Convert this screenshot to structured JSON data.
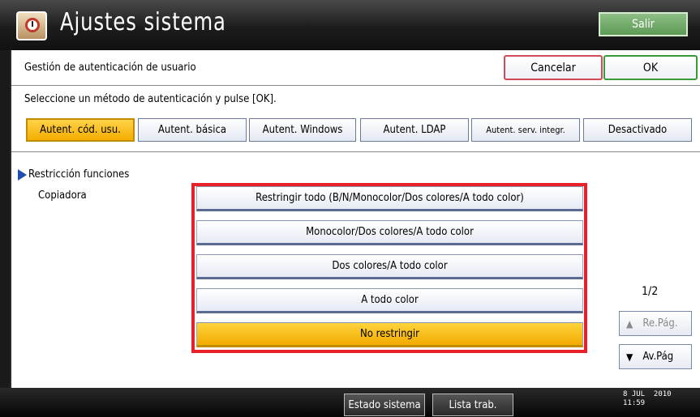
{
  "header": {
    "title": "Ajustes sistema",
    "exit_label": "Salir"
  },
  "panel": {
    "title": "Gestión de autenticación de usuario",
    "cancel_label": "Cancelar",
    "ok_label": "OK"
  },
  "instruction": "Seleccione un método de autenticación y pulse [OK].",
  "auth_methods": [
    {
      "label": "Autent. cód. usu.",
      "selected": true
    },
    {
      "label": "Autent. básica",
      "selected": false
    },
    {
      "label": "Autent. Windows",
      "selected": false
    },
    {
      "label": "Autent. LDAP",
      "selected": false
    },
    {
      "label": "Autent. serv. integr.",
      "selected": false
    },
    {
      "label": "Desactivado",
      "selected": false
    }
  ],
  "restriction": {
    "section_label": "Restricción funciones",
    "function_label": "Copiadora",
    "options": [
      {
        "label": "Restringir todo (B/N/Monocolor/Dos colores/A todo color)",
        "selected": false
      },
      {
        "label": "Monocolor/Dos colores/A todo color",
        "selected": false
      },
      {
        "label": "Dos colores/A todo color",
        "selected": false
      },
      {
        "label": "A todo color",
        "selected": false
      },
      {
        "label": "No restringir",
        "selected": true
      }
    ]
  },
  "pagination": {
    "indicator": "1/2",
    "prev_label": "Re.Pág.",
    "next_label": "Av.Pág",
    "prev_disabled": true
  },
  "footer": {
    "system_status_label": "Estado sistema",
    "job_list_label": "Lista trab.",
    "date": "8 JUL  2010",
    "time": "11:59"
  },
  "colors": {
    "selected": "#f4ae00",
    "highlight_frame": "#e8202a",
    "ok_border": "#3a9a3a",
    "cancel_border": "#d24a5a",
    "exit_button": "#5c9a55"
  }
}
